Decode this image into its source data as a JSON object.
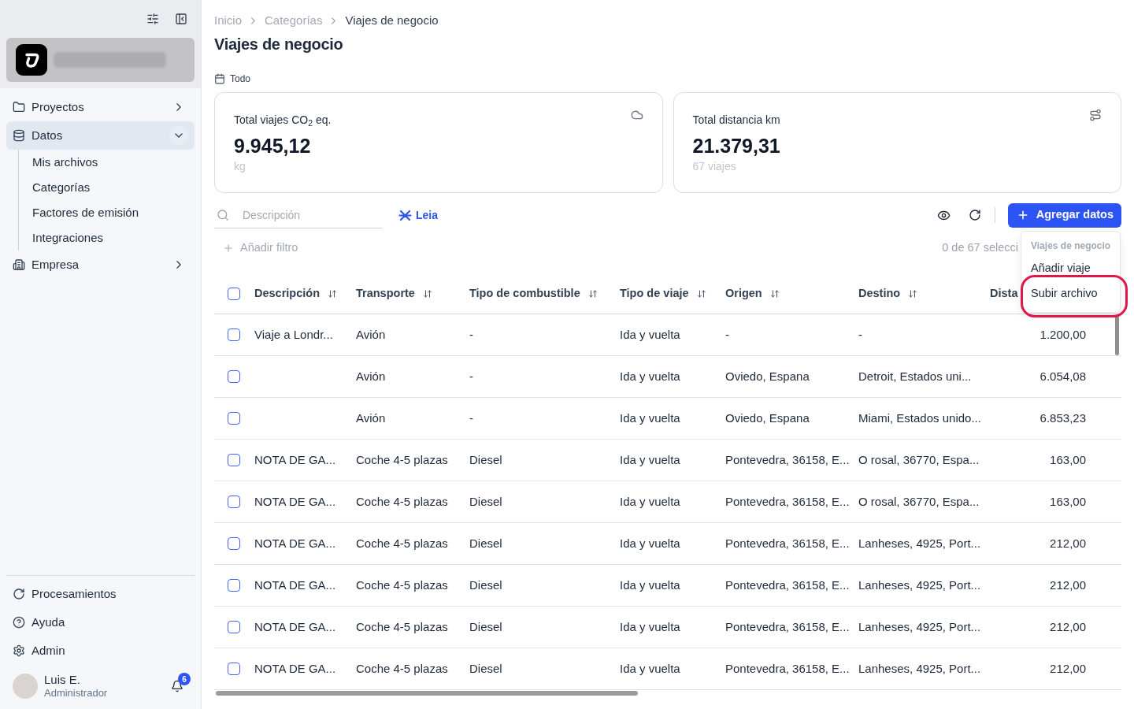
{
  "sidebar": {
    "nav": [
      {
        "label": "Proyectos",
        "selected": false,
        "expanded": false
      },
      {
        "label": "Datos",
        "selected": true,
        "expanded": true,
        "children": [
          {
            "label": "Mis archivos",
            "selected": false
          },
          {
            "label": "Categorías",
            "selected": false
          },
          {
            "label": "Factores de emisión",
            "selected": false
          },
          {
            "label": "Integraciones",
            "selected": false
          }
        ]
      },
      {
        "label": "Empresa",
        "selected": false,
        "expanded": false
      }
    ],
    "footer": [
      {
        "label": "Procesamientos"
      },
      {
        "label": "Ayuda"
      },
      {
        "label": "Admin"
      }
    ],
    "user": {
      "name": "Luis E.",
      "role": "Administrador",
      "notification_count": "6"
    }
  },
  "breadcrumb": [
    {
      "label": "Inicio",
      "current": false
    },
    {
      "label": "Categorías",
      "current": false
    },
    {
      "label": "Viajes de negocio",
      "current": true
    }
  ],
  "title": "Viajes de negocio",
  "period": "Todo",
  "cards": [
    {
      "kind": "emissions",
      "title": "Total viajes CO$_{2}$ eq.",
      "value": "9.945,12",
      "caption": "kg"
    },
    {
      "kind": "distance",
      "title": "Total distancia km",
      "value": "21.379,31",
      "caption": "67 viajes"
    }
  ],
  "toolbar": {
    "search": {
      "placeholder": "Descripción"
    },
    "assistant": "Leia",
    "add_button": "Agregar datos",
    "add_filter": "Añadir filtro",
    "selection": "0 de 67 selecci"
  },
  "menu": {
    "heading": "Viajes de negocio",
    "items": [
      {
        "label": "Añadir viaje",
        "annotated": false
      },
      {
        "label": "Subir archivo",
        "annotated": true
      }
    ]
  },
  "table": {
    "all_checked": false,
    "columns": [
      {
        "label": "Descripción",
        "sortable": true
      },
      {
        "label": "Transporte",
        "sortable": true
      },
      {
        "label": "Tipo de combustible",
        "sortable": true
      },
      {
        "label": "Tipo de viaje",
        "sortable": true
      },
      {
        "label": "Origen",
        "sortable": true
      },
      {
        "label": "Destino",
        "sortable": true
      },
      {
        "label": "Dista",
        "sortable": false
      }
    ],
    "rows": [
      {
        "checked": false,
        "cells": [
          "Viaje a Londr...",
          "Avión",
          "-",
          "Ida y vuelta",
          "-",
          "-",
          "1.200,00"
        ]
      },
      {
        "checked": false,
        "cells": [
          null,
          "Avión",
          "-",
          "Ida y vuelta",
          "Oviedo, Espana",
          "Detroit, Estados uni...",
          "6.054,08"
        ]
      },
      {
        "checked": false,
        "cells": [
          null,
          "Avión",
          "-",
          "Ida y vuelta",
          "Oviedo, Espana",
          "Miami, Estados unido...",
          "6.853,23"
        ]
      },
      {
        "checked": false,
        "cells": [
          "NOTA DE GA...",
          "Coche 4-5 plazas",
          "Diesel",
          "Ida y vuelta",
          "Pontevedra, 36158, E...",
          "O rosal, 36770, Espa...",
          "163,00"
        ]
      },
      {
        "checked": false,
        "cells": [
          "NOTA DE GA...",
          "Coche 4-5 plazas",
          "Diesel",
          "Ida y vuelta",
          "Pontevedra, 36158, E...",
          "O rosal, 36770, Espa...",
          "163,00"
        ]
      },
      {
        "checked": false,
        "cells": [
          "NOTA DE GA...",
          "Coche 4-5 plazas",
          "Diesel",
          "Ida y vuelta",
          "Pontevedra, 36158, E...",
          "Lanheses, 4925, Port...",
          "212,00"
        ]
      },
      {
        "checked": false,
        "cells": [
          "NOTA DE GA...",
          "Coche 4-5 plazas",
          "Diesel",
          "Ida y vuelta",
          "Pontevedra, 36158, E...",
          "Lanheses, 4925, Port...",
          "212,00"
        ]
      },
      {
        "checked": false,
        "cells": [
          "NOTA DE GA...",
          "Coche 4-5 plazas",
          "Diesel",
          "Ida y vuelta",
          "Pontevedra, 36158, E...",
          "Lanheses, 4925, Port...",
          "212,00"
        ]
      },
      {
        "checked": false,
        "cells": [
          "NOTA DE GA...",
          "Coche 4-5 plazas",
          "Diesel",
          "Ida y vuelta",
          "Pontevedra, 36158, E...",
          "Lanheses, 4925, Port...",
          "212,00"
        ]
      }
    ]
  }
}
